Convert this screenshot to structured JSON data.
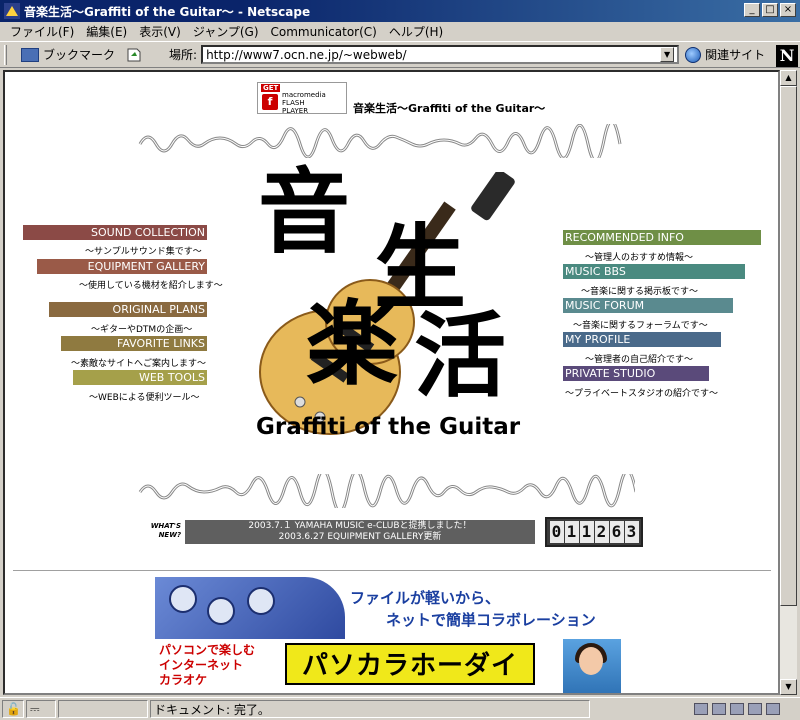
{
  "window": {
    "title": "音楽生活〜Graffiti of the Guitar〜 - Netscape",
    "buttons": [
      "_",
      "□",
      "×"
    ]
  },
  "menubar": [
    "ファイル(F)",
    "編集(E)",
    "表示(V)",
    "ジャンプ(G)",
    "Communicator(C)",
    "ヘルプ(H)"
  ],
  "toolbar": {
    "bookmarks_label": "ブックマーク",
    "location_label": "場所:",
    "url": "http://www7.ocn.ne.jp/~webweb/",
    "related_label": "関連サイト",
    "netscape_logo": "N"
  },
  "page": {
    "flash_badge": {
      "get": "GET",
      "line1": "macromedia",
      "line2": "FLASH",
      "line3": "PLAYER"
    },
    "site_title": "音楽生活〜Graffiti of the Guitar〜",
    "logo": {
      "kanji": [
        "音",
        "生",
        "楽",
        "活"
      ],
      "subtitle": "Graffiti of the Guitar"
    },
    "nav_left": [
      {
        "label": "SOUND COLLECTION",
        "desc": "〜サンプルサウンド集です〜",
        "color": "#8b4a46"
      },
      {
        "label": "EQUIPMENT GALLERY",
        "desc": "〜使用している機材を紹介します〜",
        "color": "#9a5a48"
      },
      {
        "label": "ORIGINAL PLANS",
        "desc": "〜ギターやDTMの企画〜",
        "color": "#8a6a40"
      },
      {
        "label": "FAVORITE LINKS",
        "desc": "〜素敵なサイトへご案内します〜",
        "color": "#8f7a40"
      },
      {
        "label": "WEB TOOLS",
        "desc": "〜WEBによる便利ツール〜",
        "color": "#a5a04a"
      }
    ],
    "nav_right": [
      {
        "label": "RECOMMENDED INFO",
        "desc": "〜管理人のおすすめ情報〜",
        "color": "#6f8f46"
      },
      {
        "label": "MUSIC BBS",
        "desc": "〜音楽に関する掲示板です〜",
        "color": "#4a8a80"
      },
      {
        "label": "MUSIC FORUM",
        "desc": "〜音楽に関するフォーラムです〜",
        "color": "#5a8a8f"
      },
      {
        "label": "MY PROFILE",
        "desc": "〜管理者の自己紹介です〜",
        "color": "#4a6a8a"
      },
      {
        "label": "PRIVATE STUDIO",
        "desc": "〜プライベートスタジオの紹介です〜",
        "color": "#5a4a7a"
      }
    ],
    "whats_new_label": "WHAT'S NEW?",
    "news": [
      "2003.7.１ YAMAHA MUSIC e-CLUBと提携しました！",
      "2003.6.27 EQUIPMENT GALLERY更新"
    ],
    "counter": [
      "0",
      "1",
      "1",
      "2",
      "6",
      "3"
    ],
    "banner1": {
      "line1": "ファイルが軽いから、",
      "line2": "ネットで簡単コラボレーション"
    },
    "banner2": {
      "left": [
        "パソコンで楽しむ",
        "インターネット",
        "カラオケ"
      ],
      "brand": "パソカラホーダイ"
    }
  },
  "statusbar": {
    "text": "ドキュメント: 完了。"
  }
}
